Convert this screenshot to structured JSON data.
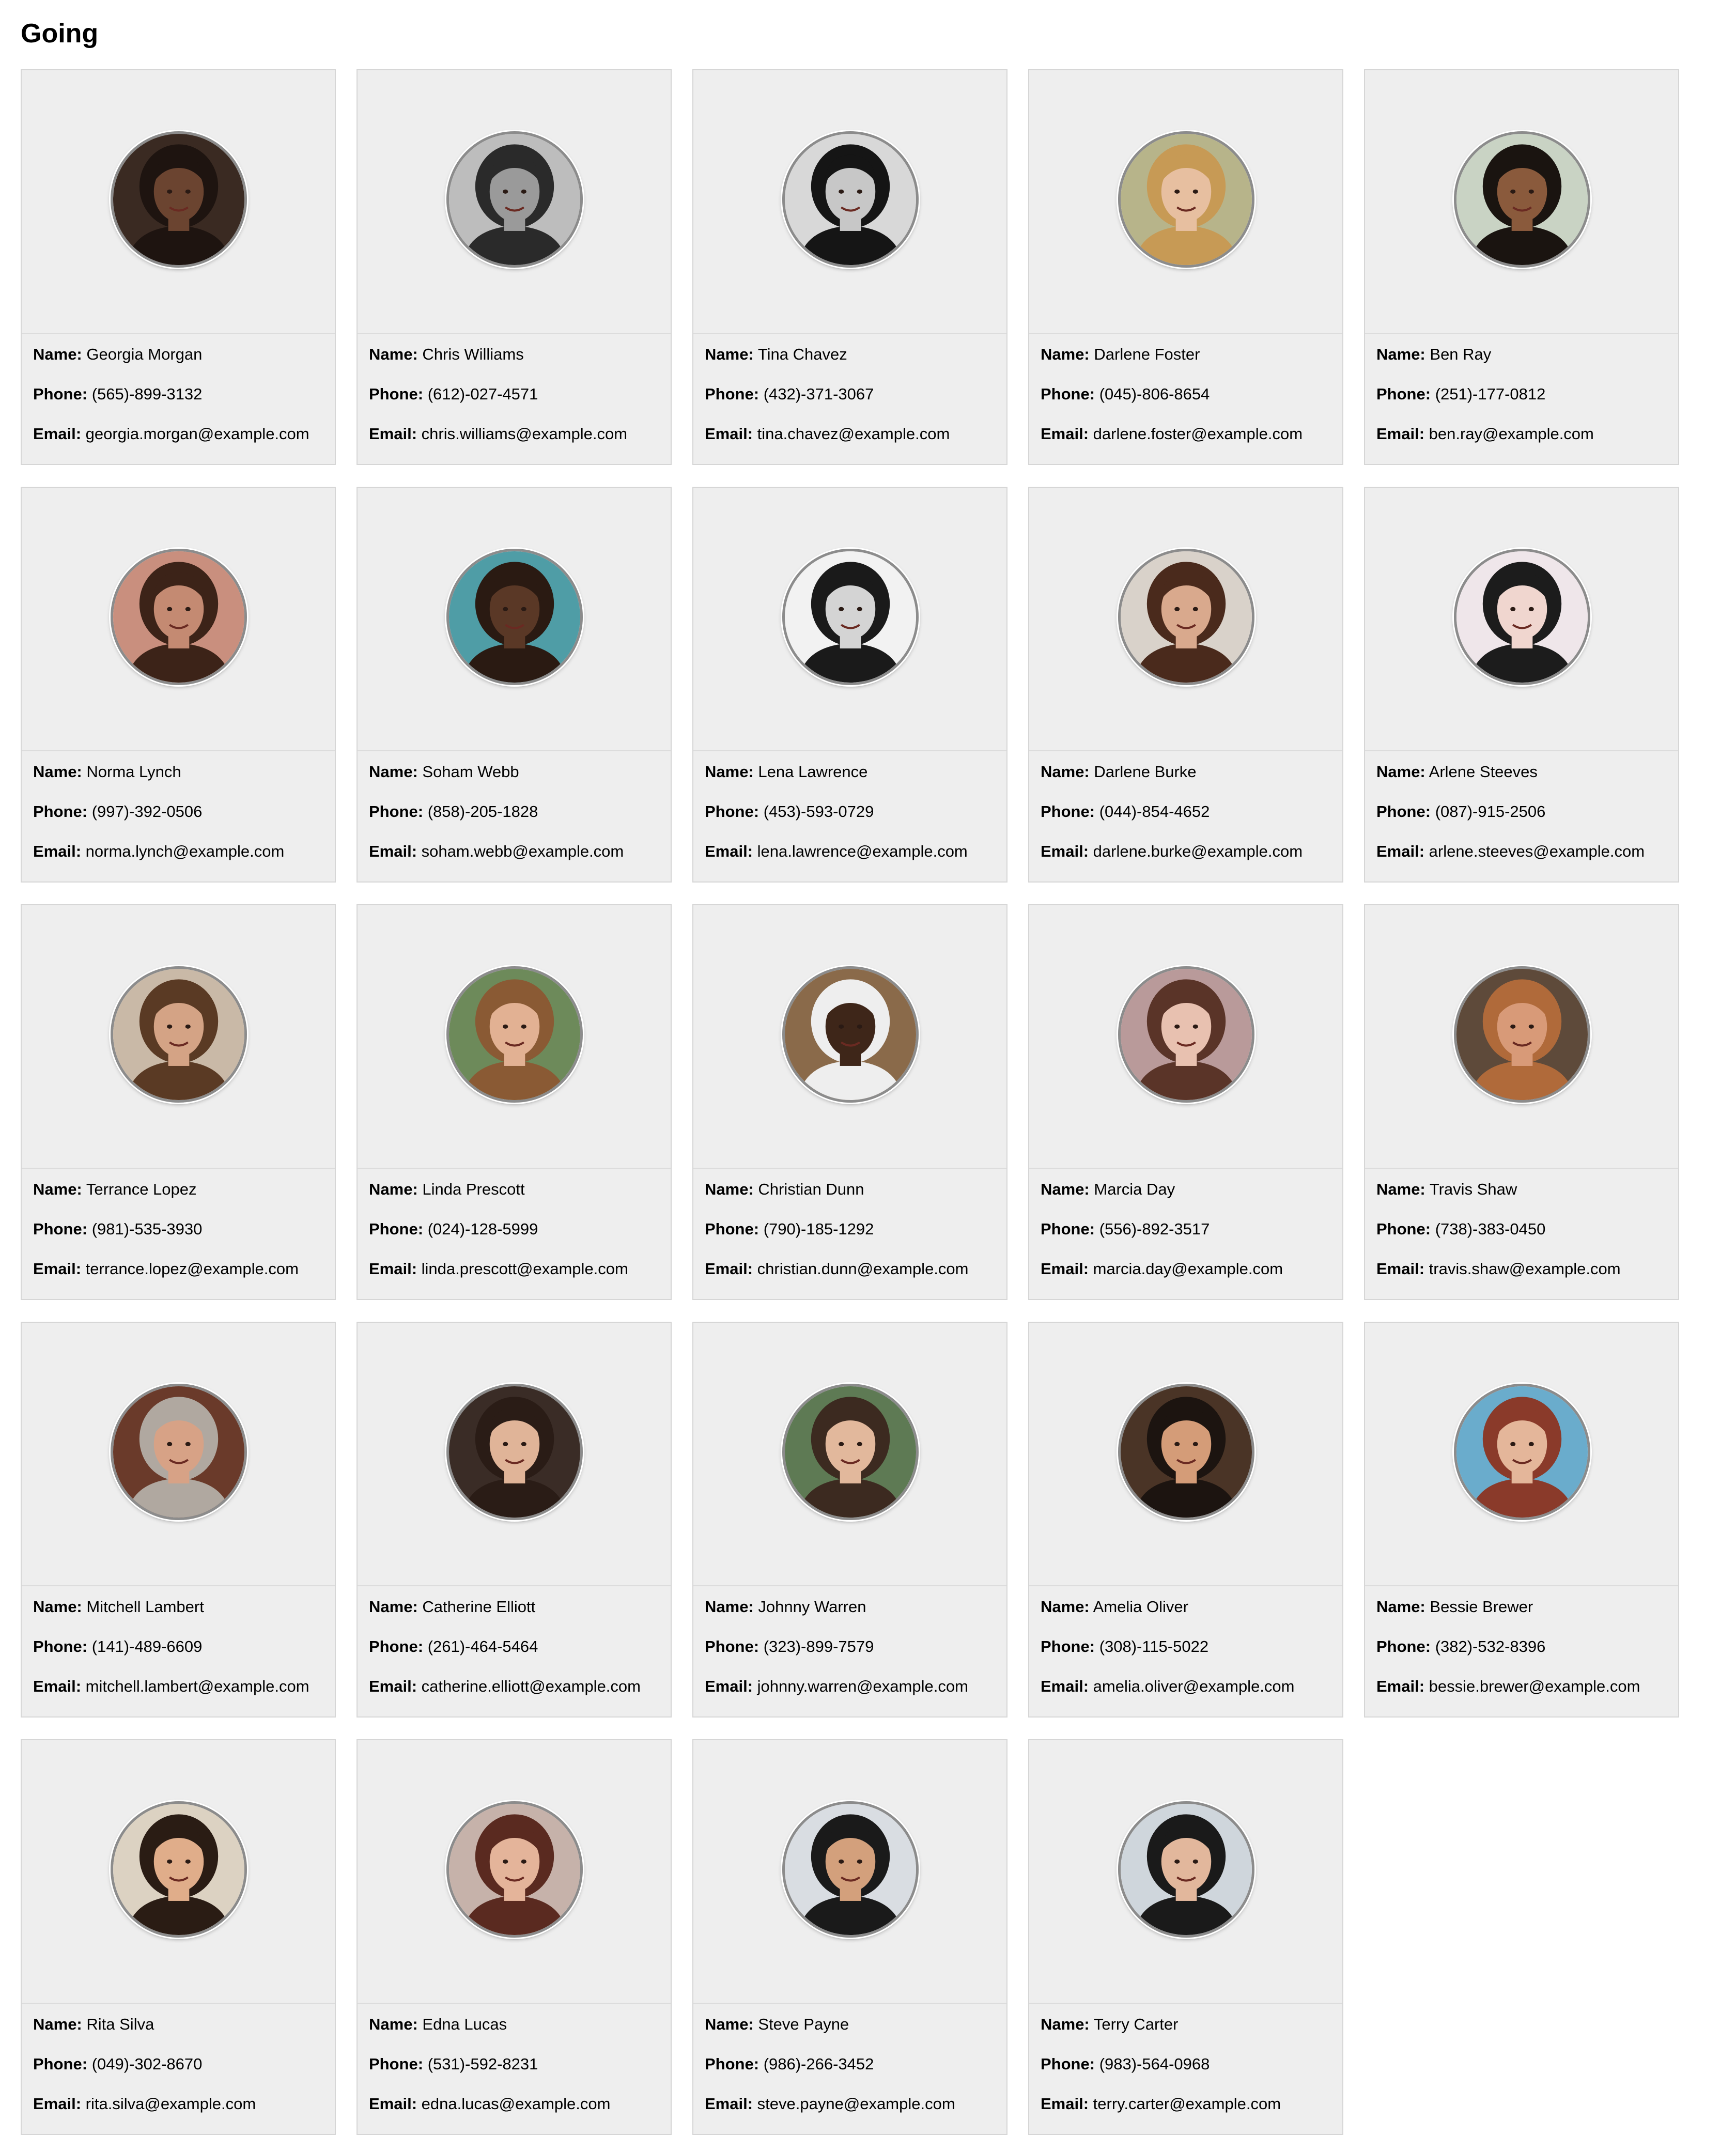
{
  "page": {
    "title": "Going",
    "labels": {
      "name": "Name:",
      "phone": "Phone:",
      "email": "Email:"
    }
  },
  "people": [
    {
      "name": "Georgia Morgan",
      "phone": "(565)-899-3132",
      "email": "georgia.morgan@example.com",
      "bg": "#3a2a22",
      "skin": "#6b4430",
      "hair": "#1e1410"
    },
    {
      "name": "Chris Williams",
      "phone": "(612)-027-4571",
      "email": "chris.williams@example.com",
      "bg": "#bdbdbd",
      "skin": "#9a9a9a",
      "hair": "#2a2a2a"
    },
    {
      "name": "Tina Chavez",
      "phone": "(432)-371-3067",
      "email": "tina.chavez@example.com",
      "bg": "#d8d8d8",
      "skin": "#c7c7c7",
      "hair": "#151515"
    },
    {
      "name": "Darlene Foster",
      "phone": "(045)-806-8654",
      "email": "darlene.foster@example.com",
      "bg": "#b7b48a",
      "skin": "#e7bfa0",
      "hair": "#c79a55"
    },
    {
      "name": "Ben Ray",
      "phone": "(251)-177-0812",
      "email": "ben.ray@example.com",
      "bg": "#c9d3c4",
      "skin": "#8a5a3c",
      "hair": "#1a1410"
    },
    {
      "name": "Norma Lynch",
      "phone": "(997)-392-0506",
      "email": "norma.lynch@example.com",
      "bg": "#c98f7e",
      "skin": "#c48a72",
      "hair": "#3c2318"
    },
    {
      "name": "Soham Webb",
      "phone": "(858)-205-1828",
      "email": "soham.webb@example.com",
      "bg": "#4f9da6",
      "skin": "#5a3826",
      "hair": "#2a1a12"
    },
    {
      "name": "Lena Lawrence",
      "phone": "(453)-593-0729",
      "email": "lena.lawrence@example.com",
      "bg": "#f2f2f2",
      "skin": "#d4d4d4",
      "hair": "#1a1a1a"
    },
    {
      "name": "Darlene Burke",
      "phone": "(044)-854-4652",
      "email": "darlene.burke@example.com",
      "bg": "#d9d2ca",
      "skin": "#d9a98d",
      "hair": "#4a2a1c"
    },
    {
      "name": "Arlene Steeves",
      "phone": "(087)-915-2506",
      "email": "arlene.steeves@example.com",
      "bg": "#efe6ea",
      "skin": "#f0d6cf",
      "hair": "#1c1c1c"
    },
    {
      "name": "Terrance Lopez",
      "phone": "(981)-535-3930",
      "email": "terrance.lopez@example.com",
      "bg": "#c9b9a7",
      "skin": "#d4a385",
      "hair": "#5a3a24"
    },
    {
      "name": "Linda Prescott",
      "phone": "(024)-128-5999",
      "email": "linda.prescott@example.com",
      "bg": "#6d8a5a",
      "skin": "#e2b193",
      "hair": "#8a5a34"
    },
    {
      "name": "Christian Dunn",
      "phone": "(790)-185-1292",
      "email": "christian.dunn@example.com",
      "bg": "#8a6a4a",
      "skin": "#3e2619",
      "hair": "#eeeeee"
    },
    {
      "name": "Marcia Day",
      "phone": "(556)-892-3517",
      "email": "marcia.day@example.com",
      "bg": "#b99a9a",
      "skin": "#e8c1b0",
      "hair": "#5a3428"
    },
    {
      "name": "Travis Shaw",
      "phone": "(738)-383-0450",
      "email": "travis.shaw@example.com",
      "bg": "#5e4a3a",
      "skin": "#d89a78",
      "hair": "#b06a3a"
    },
    {
      "name": "Mitchell Lambert",
      "phone": "(141)-489-6609",
      "email": "mitchell.lambert@example.com",
      "bg": "#6a3a2a",
      "skin": "#d7a286",
      "hair": "#b0a8a0"
    },
    {
      "name": "Catherine Elliott",
      "phone": "(261)-464-5464",
      "email": "catherine.elliott@example.com",
      "bg": "#3a2c26",
      "skin": "#e0b498",
      "hair": "#2a1c16"
    },
    {
      "name": "Johnny Warren",
      "phone": "(323)-899-7579",
      "email": "johnny.warren@example.com",
      "bg": "#5e7a54",
      "skin": "#e2b89c",
      "hair": "#3c2a20"
    },
    {
      "name": "Amelia Oliver",
      "phone": "(308)-115-5022",
      "email": "amelia.oliver@example.com",
      "bg": "#4a3426",
      "skin": "#d49c78",
      "hair": "#1c1410"
    },
    {
      "name": "Bessie Brewer",
      "phone": "(382)-532-8396",
      "email": "bessie.brewer@example.com",
      "bg": "#6aaccc",
      "skin": "#e4b69a",
      "hair": "#8a3a2a"
    },
    {
      "name": "Rita Silva",
      "phone": "(049)-302-8670",
      "email": "rita.silva@example.com",
      "bg": "#dcd2c2",
      "skin": "#e0ad8a",
      "hair": "#2a1c14"
    },
    {
      "name": "Edna Lucas",
      "phone": "(531)-592-8231",
      "email": "edna.lucas@example.com",
      "bg": "#c6b2aa",
      "skin": "#e4b49a",
      "hair": "#5a2a20"
    },
    {
      "name": "Steve Payne",
      "phone": "(986)-266-3452",
      "email": "steve.payne@example.com",
      "bg": "#d9dde2",
      "skin": "#d3a07c",
      "hair": "#1a1a1a"
    },
    {
      "name": "Terry Carter",
      "phone": "(983)-564-0968",
      "email": "terry.carter@example.com",
      "bg": "#cfd6dc",
      "skin": "#e2b79c",
      "hair": "#1a1a1a"
    }
  ]
}
